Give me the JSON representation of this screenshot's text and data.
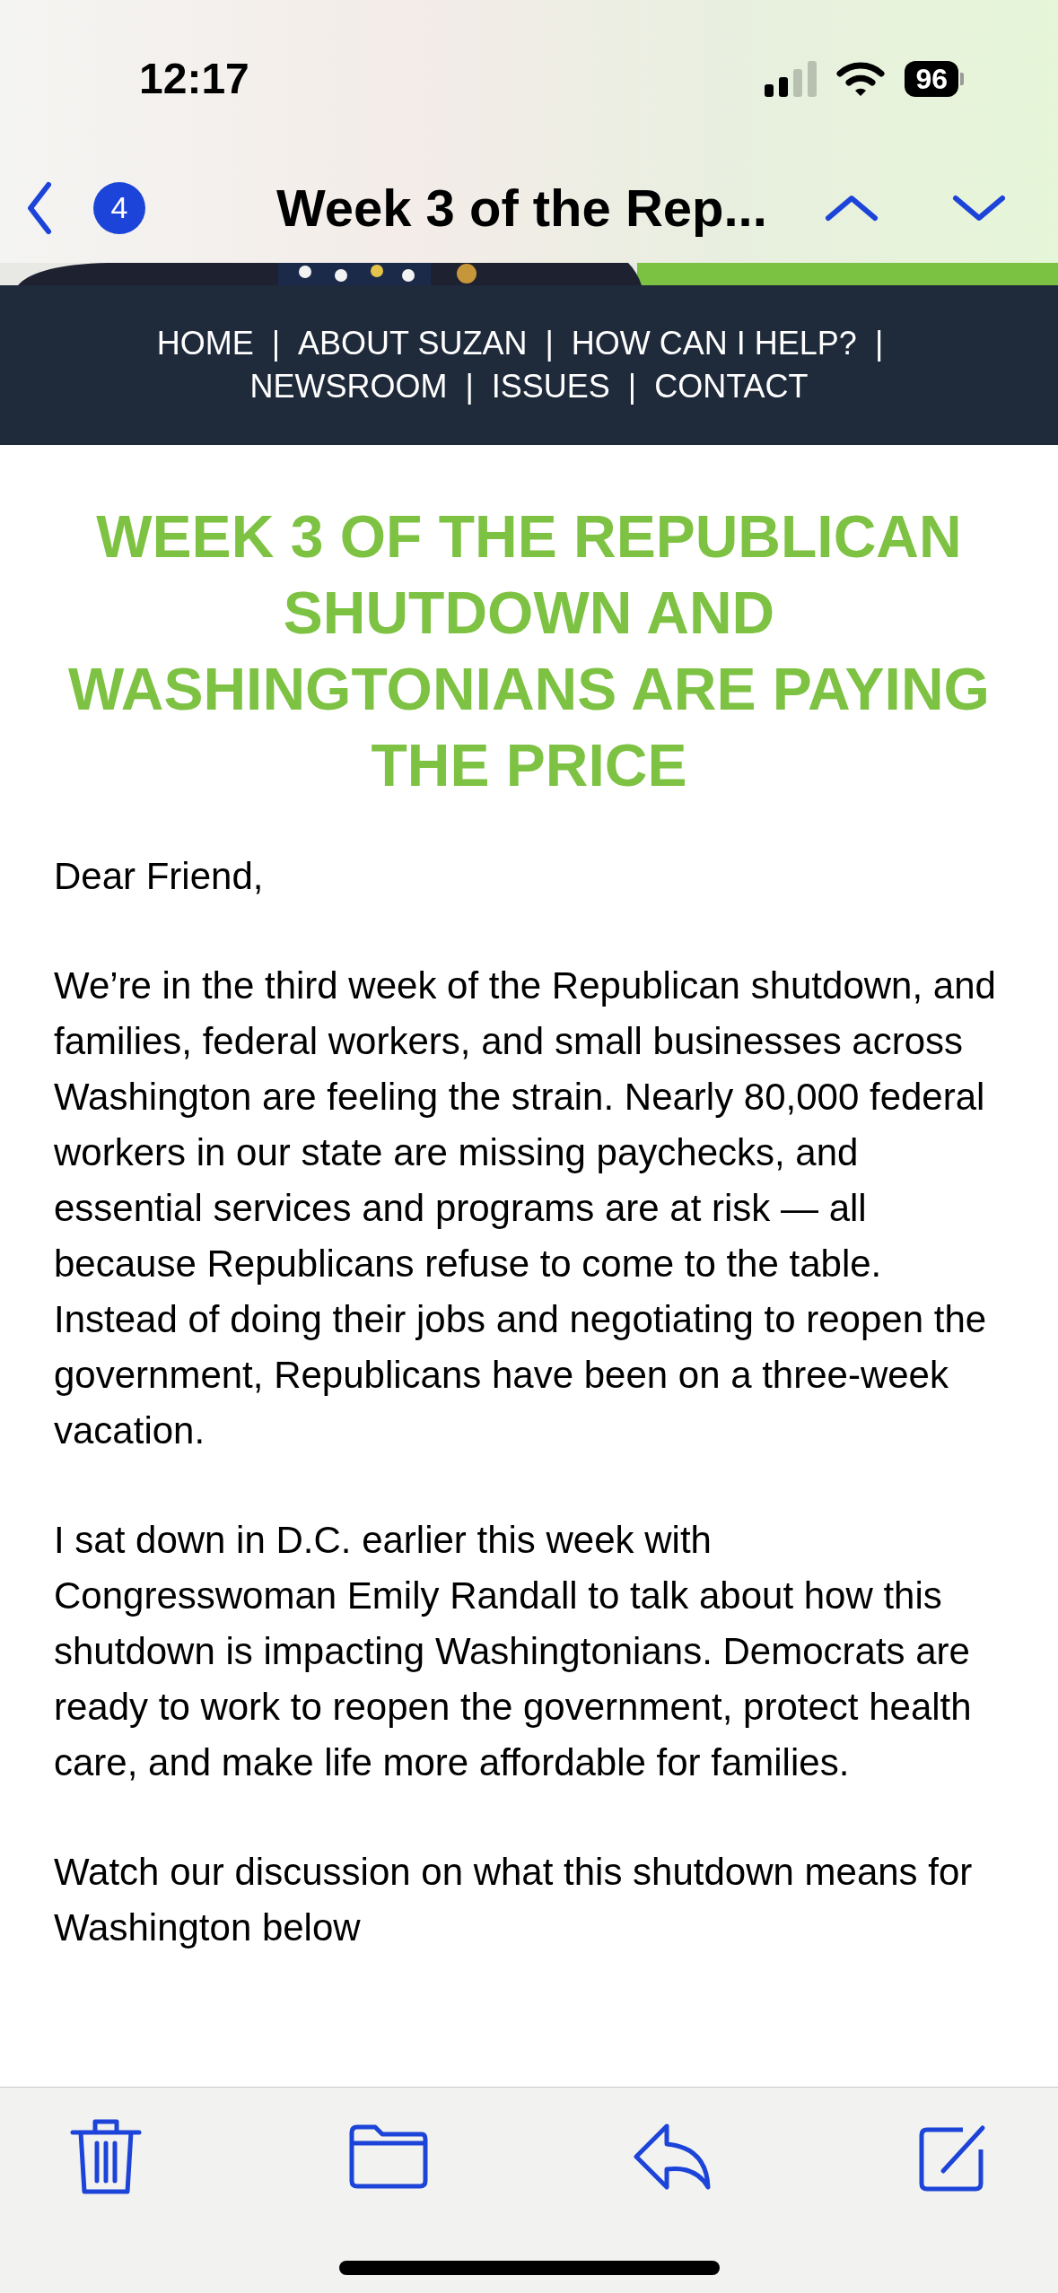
{
  "status_bar": {
    "time": "12:17",
    "battery": "96"
  },
  "nav_bar": {
    "unread_count": "4",
    "title": "Week 3 of the Rep..."
  },
  "email": {
    "menu": [
      {
        "label": "HOME",
        "separator": "|"
      },
      {
        "label": "ABOUT SUZAN",
        "separator": "|"
      },
      {
        "label": "HOW CAN I HELP?",
        "separator": "|"
      },
      {
        "label": "NEWSROOM",
        "separator": "|"
      },
      {
        "label": "ISSUES",
        "separator": "|"
      },
      {
        "label": "CONTACT"
      }
    ],
    "headline": "WEEK 3 OF THE REPUBLICAN SHUTDOWN AND WASHINGTONIANS ARE PAYING THE PRICE",
    "paragraphs": [
      "Dear Friend,",
      "We’re in the third week of the Republican shutdown, and families, federal workers, and small businesses across Washington are feeling the strain. Nearly 80,000 federal workers in our state are missing paychecks, and essential services and programs are at risk — all because Republicans refuse to come to the table. Instead of doing their jobs and negotiating to reopen the government, Republicans have been on a three-week vacation.",
      "I sat down in D.C. earlier this week with Congresswoman Emily Randall to talk about how this shutdown is impacting Washingtonians. Democrats are ready to work to reopen the government, protect health care, and make life more affordable for families.",
      "Watch our discussion on what this shutdown means for Washington below"
    ]
  }
}
